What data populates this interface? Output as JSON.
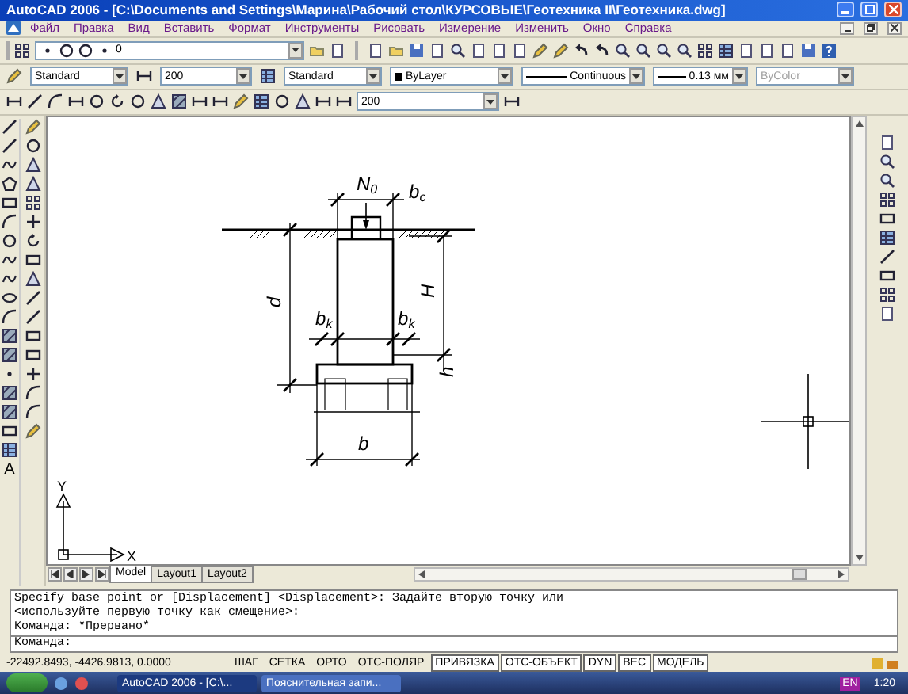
{
  "window": {
    "title": "AutoCAD 2006 - [C:\\Documents and Settings\\Марина\\Рабочий стол\\КУРСОВЫЕ\\Геотехника II\\Геотехника.dwg]"
  },
  "menu": [
    "Файл",
    "Правка",
    "Вид",
    "Вставить",
    "Формат",
    "Инструменты",
    "Рисовать",
    "Измерение",
    "Изменить",
    "Окно",
    "Справка"
  ],
  "layer_dropdown": {
    "value": "0"
  },
  "style_dropdowns": [
    {
      "value": "Standard",
      "disabled": false
    },
    {
      "value": "200",
      "disabled": false
    },
    {
      "value": "Standard",
      "disabled": false
    },
    {
      "value": "ByLayer",
      "disabled": false
    },
    {
      "value": "Continuous",
      "disabled": false
    },
    {
      "value": "0.13 мм",
      "disabled": false
    },
    {
      "value": "ByColor",
      "disabled": true
    }
  ],
  "dimension_scale": {
    "value": "200"
  },
  "text_tool": "A",
  "drawing": {
    "labels": [
      "N$_{0}$",
      "b$_{c}$",
      "d",
      "H",
      "b$_{k}$",
      "b$_{k}$",
      "h",
      "b"
    ],
    "ucs": {
      "x": "X",
      "y": "Y"
    }
  },
  "layout_tabs": [
    {
      "label": "Model",
      "selected": true
    },
    {
      "label": "Layout1",
      "selected": false
    },
    {
      "label": "Layout2",
      "selected": false
    }
  ],
  "command_lines": [
    "Specify base point or [Displacement] <Displacement>: Задайте вторую точку или",
    "<используйте первую точку как смещение>:",
    "Команда: *Прервано*"
  ],
  "command_prompt": "Команда:",
  "status_bar": {
    "coordinates": "-22492.8493, -4426.9813, 0.0000",
    "toggles": [
      {
        "label": "ШАГ",
        "on": false
      },
      {
        "label": "СЕТКА",
        "on": false
      },
      {
        "label": "ОРТО",
        "on": false
      },
      {
        "label": "ОТС-ПОЛЯР",
        "on": false
      },
      {
        "label": "ПРИВЯЗКА",
        "on": true
      },
      {
        "label": "ОТС-ОБЪЕКТ",
        "on": true
      },
      {
        "label": "DYN",
        "on": true
      },
      {
        "label": "ВЕС",
        "on": true
      },
      {
        "label": "МОДЕЛЬ",
        "on": true
      }
    ]
  },
  "taskbar": {
    "windows": [
      {
        "label": "AutoCAD 2006 - [C:\\...",
        "selected": true
      },
      {
        "label": "Пояснительная запи...",
        "selected": false
      }
    ],
    "language": "EN",
    "clock": "1:20"
  }
}
